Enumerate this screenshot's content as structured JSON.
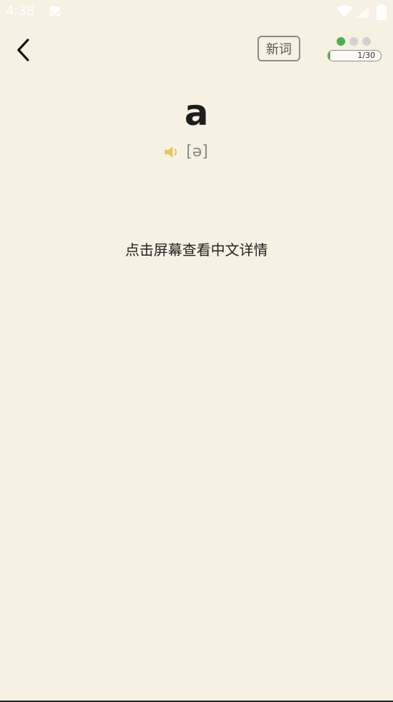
{
  "status_bar": {
    "time": "4:38"
  },
  "header": {
    "new_word_label": "新词",
    "dots": [
      true,
      false,
      false
    ],
    "progress": {
      "text": "1/30",
      "current": 1,
      "total": 30,
      "fill_color": "#4cae52"
    }
  },
  "card": {
    "word": "a",
    "phonetic": "[ə]",
    "hint": "点击屏幕查看中文详情"
  },
  "colors": {
    "background": "#f6f1e2",
    "speaker": "#e8c468",
    "accent": "#4cae52"
  }
}
